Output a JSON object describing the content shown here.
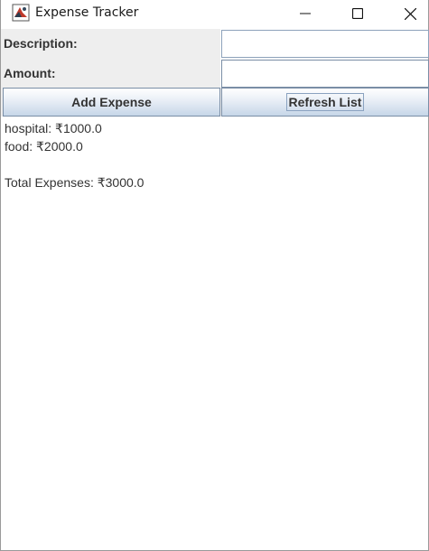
{
  "window": {
    "title": "Expense Tracker",
    "icon": "java-app-icon",
    "controls": [
      "minimize-icon",
      "maximize-icon",
      "close-icon"
    ]
  },
  "form": {
    "description_label": "Description:",
    "description_value": "",
    "amount_label": "Amount:",
    "amount_value": ""
  },
  "buttons": {
    "add_label": "Add Expense",
    "refresh_label": "Refresh List"
  },
  "expenses": {
    "items": [
      "hospital: ₹1000.0",
      "food: ₹2000.0"
    ],
    "total": "Total Expenses: ₹3000.0"
  },
  "colors": {
    "button_border": "#7a8ea6",
    "button_gradient_bottom": "#c6d6e8",
    "label_background": "#eeeeee"
  }
}
